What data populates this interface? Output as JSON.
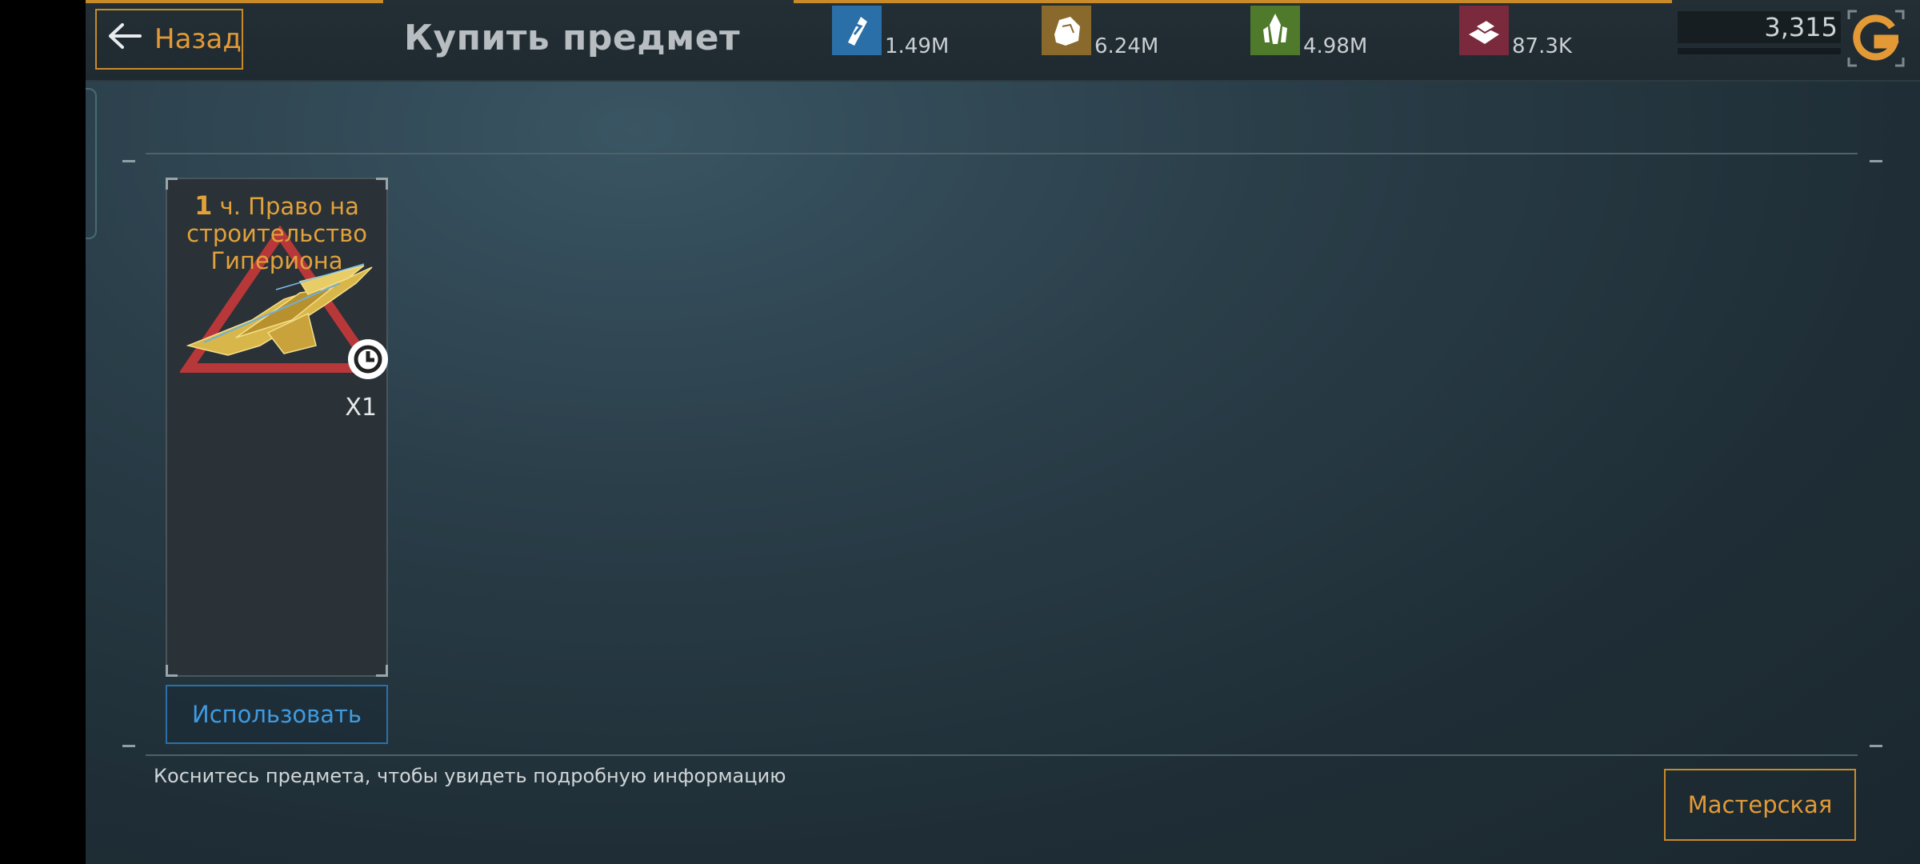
{
  "header": {
    "back_label": "Назад",
    "title": "Купить предмет"
  },
  "resources": [
    {
      "icon": "energy-crystal-icon",
      "value": "1.49M",
      "color": "#2b6fa8"
    },
    {
      "icon": "metal-ore-icon",
      "value": "6.24M",
      "color": "#8a6a2c"
    },
    {
      "icon": "crystal-cluster-icon",
      "value": "4.98M",
      "color": "#4f7a2c"
    },
    {
      "icon": "alloy-bars-icon",
      "value": "87.3K",
      "color": "#7a2a3c"
    }
  ],
  "premium": {
    "value": "3,315",
    "icon": "g-currency-icon"
  },
  "item": {
    "title_num": "1",
    "title_text": " ч. Право на строительство Гипериона",
    "quantity": "X1",
    "art_icon": "hyperion-ship-icon",
    "timer_icon": "clock-icon"
  },
  "actions": {
    "use_label": "Использовать",
    "workshop_label": "Мастерская"
  },
  "hint": "Коснитесь предмета, чтобы увидеть подробную информацию",
  "colors": {
    "accent": "#e39a36",
    "blue_button": "#3f9be0",
    "title_gold": "#e2a23a"
  }
}
